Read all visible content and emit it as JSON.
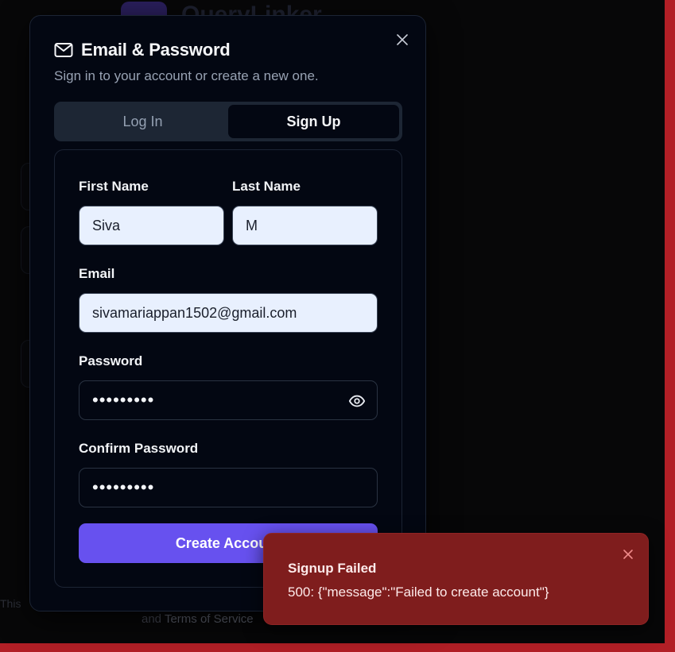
{
  "background": {
    "brand": "QueryLinker",
    "footer_text": "This",
    "footer_terms_prefix": "and",
    "footer_terms_link": "Terms of Service"
  },
  "dialog": {
    "title": "Email & Password",
    "subtitle": "Sign in to your account or create a new one.",
    "title_icon": "mail-icon",
    "close_icon": "close-icon"
  },
  "tabs": [
    {
      "label": "Log In",
      "active": false
    },
    {
      "label": "Sign Up",
      "active": true
    }
  ],
  "form": {
    "first_name": {
      "label": "First Name",
      "value": "Siva"
    },
    "last_name": {
      "label": "Last Name",
      "value": "M"
    },
    "email": {
      "label": "Email",
      "value": "sivamariappan1502@gmail.com"
    },
    "password": {
      "label": "Password",
      "masked": "•••••••••",
      "toggle_icon": "eye-icon"
    },
    "confirm_password": {
      "label": "Confirm Password",
      "masked": "•••••••••"
    },
    "submit_label": "Create Account"
  },
  "toast": {
    "title": "Signup Failed",
    "message": "500: {\"message\":\"Failed to create account\"}",
    "close_icon": "close-icon"
  },
  "colors": {
    "accent": "#6751ef",
    "error_bg": "#7f1d1d",
    "dialog_bg": "#030712",
    "input_filled_bg": "#e8f0fe"
  }
}
